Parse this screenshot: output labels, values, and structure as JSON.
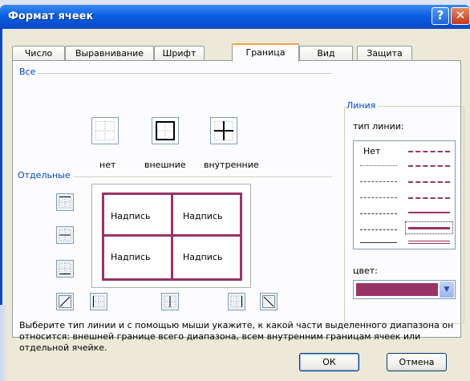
{
  "window": {
    "title": "Формат ячеек",
    "help_glyph": "?",
    "close_glyph": "✕"
  },
  "tabs": [
    {
      "label": "Число",
      "active": false
    },
    {
      "label": "Выравнивание",
      "active": false
    },
    {
      "label": "Шрифт",
      "active": false
    },
    {
      "label": "Граница",
      "active": true
    },
    {
      "label": "Вид",
      "active": false
    },
    {
      "label": "Защита",
      "active": false
    }
  ],
  "border_tab": {
    "all_group": "Все",
    "presets": [
      {
        "label": "нет"
      },
      {
        "label": "внешние"
      },
      {
        "label": "внутренние"
      }
    ],
    "separate_group": "Отдельные",
    "preview_cells": [
      "Надпись",
      "Надпись",
      "Надпись",
      "Надпись"
    ],
    "hint": "Выберите тип линии и с помощью мыши укажите, к какой части выделенного диапазона он относится: внешней границе всего диапазона, всем внутренним границам ячеек или отдельной ячейке."
  },
  "line_group": {
    "title": "Линия",
    "style_label": "тип линии:",
    "none_option": "Нет",
    "color_label": "цвет:",
    "color_value": "#993366"
  },
  "buttons": {
    "ok": "ОК",
    "cancel": "Отмена"
  },
  "colors": {
    "titlebar": "#0a5fe2",
    "accent_border": "#993366",
    "group_title": "#0046d5",
    "dialog_bg": "#ece9d8"
  }
}
